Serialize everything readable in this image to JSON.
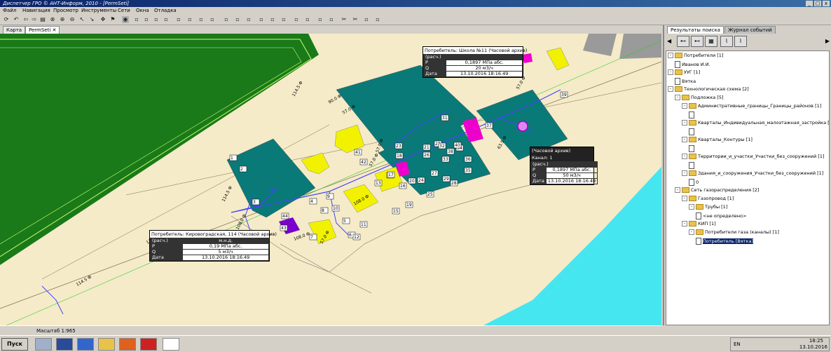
{
  "window": {
    "title": "Диспетчер ГРО © АНТ-Информ, 2010 - [PermSeti]",
    "min": "_",
    "max": "□",
    "close": "x"
  },
  "menu": [
    "Файл",
    "Навигация",
    "Просмотр",
    "Инструменты",
    "Сети",
    "Окна",
    "Отладка"
  ],
  "tabs": [
    {
      "label": "Карта"
    },
    {
      "label": "PermSeti"
    }
  ],
  "tab_close": "✕",
  "map": {
    "parcel_labels": [
      "1",
      "2",
      "3",
      "4",
      "5",
      "6",
      "7",
      "8",
      "9",
      "10",
      "11",
      "12",
      "13",
      "14",
      "15",
      "16",
      "17",
      "18",
      "19",
      "20",
      "21",
      "22",
      "23",
      "24",
      "25",
      "26",
      "27",
      "28",
      "29",
      "30",
      "31",
      "32",
      "33",
      "34",
      "35",
      "36",
      "37",
      "38",
      "39",
      "40",
      "41",
      "42",
      "43",
      "44"
    ],
    "pipe_labels": [
      "114.5 Ф",
      "108.0 Ф",
      "114.5 Ф",
      "90.0 Ф",
      "57.0 Ф",
      "108.0 Ф",
      "114.5 Ф",
      "57.0 Ф",
      "63.5 Ф",
      "57.0 Ф",
      "114.5 Ф",
      "108.0 Ф",
      "57.0 Ф",
      "57.0 Ф"
    ]
  },
  "popups": [
    {
      "title": "Потребитель: Школа №11 (Часовой архив)",
      "sub": "(расч.)",
      "rows": [
        {
          "k": "P",
          "v": "0,1897 МПа абс."
        },
        {
          "k": "Q",
          "v": "20 м3/ч"
        },
        {
          "k": "Дата",
          "v": "13.10.2016 18:16.49"
        }
      ]
    },
    {
      "title": "(Часовой архив)",
      "channel": "Канал: 1",
      "sub": "(расч.)",
      "rows": [
        {
          "k": "P",
          "v": "0,1897 МПа абс."
        },
        {
          "k": "Q",
          "v": "50 м3/ч"
        },
        {
          "k": "Дата",
          "v": "13.10.2016 18:16.49"
        }
      ]
    },
    {
      "title": "Потребитель: Кировоградская, 114 (Часовой архив)",
      "sub": "(расч.)",
      "sub_val": "м.н.д.",
      "rows": [
        {
          "k": "P",
          "v": "0,19 МПа абс."
        },
        {
          "k": "Q",
          "v": "5 м3/ч"
        },
        {
          "k": "Дата",
          "v": "13.10.2016 18:16.49"
        }
      ]
    }
  ],
  "status": {
    "scale": "Масштаб 1:965"
  },
  "right_panel": {
    "tabs": [
      {
        "label": "Результаты поиска"
      },
      {
        "label": "Журнал событий"
      }
    ],
    "tree": [
      {
        "label": "Потребители [1]",
        "level": 0,
        "type": "folder",
        "expand": "-"
      },
      {
        "label": "Иванов И.И.",
        "level": 1,
        "type": "doc"
      },
      {
        "label": "УУГ [1]",
        "level": 0,
        "type": "folder",
        "expand": "-"
      },
      {
        "label": "Вятка",
        "level": 1,
        "type": "doc"
      },
      {
        "label": "Технологическая схема [2]",
        "level": 0,
        "type": "folder",
        "expand": "-"
      },
      {
        "label": "Подложка [5]",
        "level": 1,
        "type": "folder",
        "expand": "-"
      },
      {
        "label": "Административные_границы_Границы_районов [1]",
        "level": 2,
        "type": "folder",
        "expand": "-"
      },
      {
        "label": "",
        "level": 3,
        "type": "doc"
      },
      {
        "label": "Кварталы_Индивидуальная_малоэтажная_застройка [1]",
        "level": 2,
        "type": "folder",
        "expand": "-"
      },
      {
        "label": "",
        "level": 3,
        "type": "doc"
      },
      {
        "label": "Кварталы_Контуры [1]",
        "level": 2,
        "type": "folder",
        "expand": "-"
      },
      {
        "label": "",
        "level": 3,
        "type": "doc"
      },
      {
        "label": "Территории_и_участки_Участки_без_сооружений [1]",
        "level": 2,
        "type": "folder",
        "expand": "-"
      },
      {
        "label": "",
        "level": 3,
        "type": "doc"
      },
      {
        "label": "Здания_и_сооружения_Участки_без_сооружений [1]",
        "level": 2,
        "type": "folder",
        "expand": "-"
      },
      {
        "label": "0",
        "level": 3,
        "type": "doc"
      },
      {
        "label": "Сеть газораспределения [2]",
        "level": 1,
        "type": "folder",
        "expand": "-"
      },
      {
        "label": "Газопровод [1]",
        "level": 2,
        "type": "folder",
        "expand": "-"
      },
      {
        "label": "Трубы [1]",
        "level": 3,
        "type": "folder",
        "expand": "-"
      },
      {
        "label": "<не определено>",
        "level": 4,
        "type": "doc"
      },
      {
        "label": "КИП [1]",
        "level": 2,
        "type": "folder",
        "expand": "-"
      },
      {
        "label": "Потребители газа (каналы) [1]",
        "level": 3,
        "type": "folder",
        "expand": "-"
      },
      {
        "label": "Потребитель [Вятка]",
        "level": 4,
        "type": "doc",
        "selected": true
      }
    ]
  },
  "taskbar": {
    "start": "Пуск",
    "lang": "EN",
    "time": "18:25",
    "date": "13.10.2016"
  },
  "colors": {
    "teal": "#0a7a78",
    "yellow": "#f2f200",
    "magenta": "#ee00cc",
    "green": "#1a7a1a",
    "water": "#46e6f0",
    "bg": "#f5ebc8"
  }
}
